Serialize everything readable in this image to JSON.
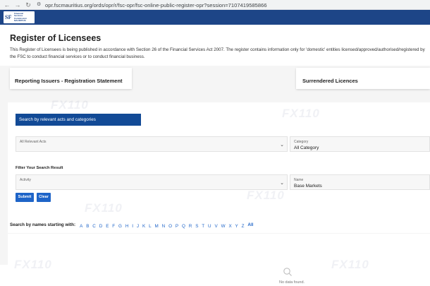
{
  "browser": {
    "url": "opr.fscmauritius.org/ords/opr/r/fsc-opr/fsc-online-public-register-opr?session=7107419585866",
    "back_icon": "arrow-left-icon",
    "forward_icon": "arrow-right-icon",
    "reload_icon": "reload-icon"
  },
  "header": {
    "logo_text_1": "Financial",
    "logo_text_2": "Services",
    "logo_text_3": "Commission",
    "logo_text_4": "MAURITIUS",
    "brand_color": "#1d4587"
  },
  "page": {
    "title": "Register of Licensees",
    "intro": "This Register of Licensees is being published in accordance with Section 26 of the Financial Services Act 2007. The register contains information only for 'domestic' entities licensed/approved/authorised/registered by the FSC to conduct financial services or to conduct financial business."
  },
  "cards": {
    "reporting": "Reporting Issuers - Registration Statement",
    "surrendered": "Surrendered Licences"
  },
  "search": {
    "banner": "Search by relevant acts and categories",
    "acts_label": "All Relevant Acts",
    "acts_value": "",
    "category_label": "Category",
    "category_value": "All Category",
    "filter_label": "Filter Your Search Result",
    "activity_label": "Activity",
    "activity_value": "",
    "name_label": "Name",
    "name_value": "Base Markets",
    "submit": "Submit",
    "clear": "Clear"
  },
  "alphabet": {
    "label": "Search by names starting with:",
    "letters": [
      "A",
      "B",
      "C",
      "D",
      "E",
      "F",
      "G",
      "H",
      "I",
      "J",
      "K",
      "L",
      "M",
      "N",
      "O",
      "P",
      "Q",
      "R",
      "S",
      "T",
      "U",
      "V",
      "W",
      "X",
      "Y",
      "Z"
    ],
    "all": "All",
    "link_color": "#1e64c8"
  },
  "results": {
    "empty_text": "No data found.",
    "icon": "search-icon"
  }
}
